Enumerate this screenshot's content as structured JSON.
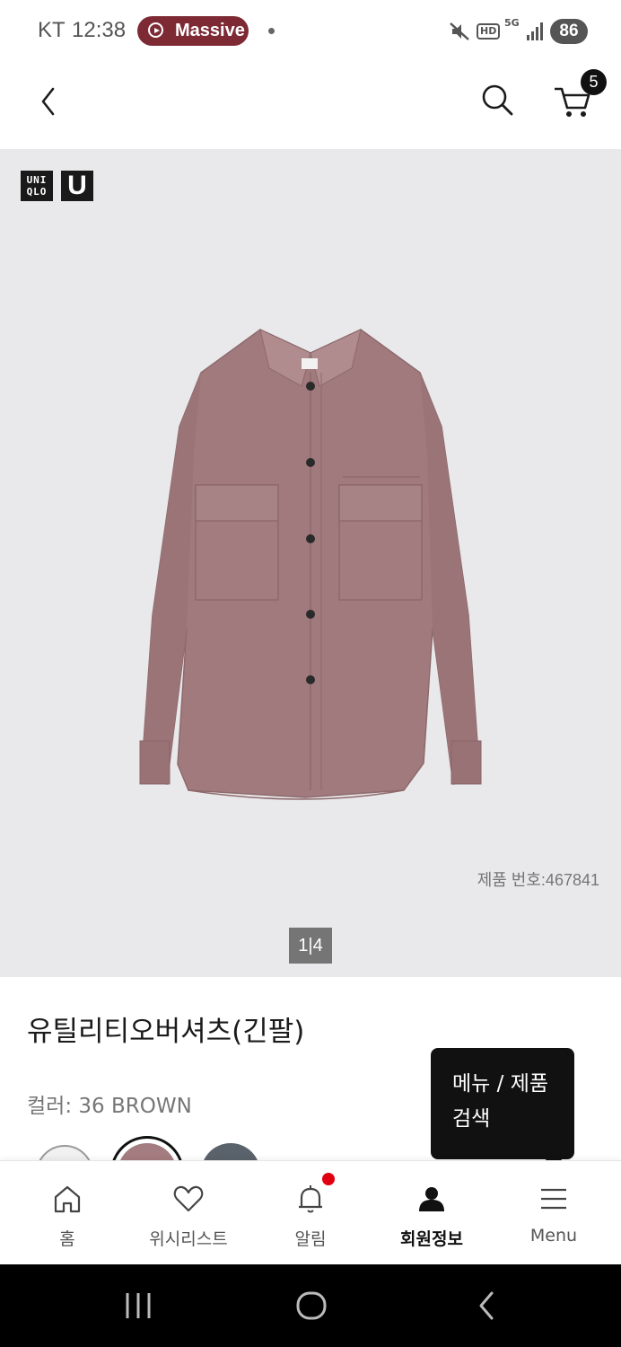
{
  "status_bar": {
    "carrier": "KT",
    "time": "12:38",
    "media_label": "Massive",
    "battery": "86",
    "hd": "HD",
    "network": "5G"
  },
  "header": {
    "cart_count": "5"
  },
  "product": {
    "brand_logo": "UNI QLO",
    "sub_logo": "U",
    "product_number": "제품 번호:467841",
    "pager": "1|4",
    "title": "유틸리티오버셔츠(긴팔)",
    "color_label": "컬러: 36 BROWN",
    "swatch_colors": [
      "#f1f1f1",
      "#a47d80",
      "#5a626b"
    ]
  },
  "tooltip": {
    "line1": "메뉴 / 제품",
    "line2": "검색"
  },
  "bottom_nav": {
    "items": [
      {
        "label": "홈",
        "icon": "home-icon"
      },
      {
        "label": "위시리스트",
        "icon": "heart-icon"
      },
      {
        "label": "알림",
        "icon": "bell-icon"
      },
      {
        "label": "회원정보",
        "icon": "person-icon"
      },
      {
        "label": "Menu",
        "icon": "menu-icon"
      }
    ]
  },
  "colors": {
    "brand_dark": "#111111",
    "notification": "#e00012",
    "media_chip": "#7d2a35",
    "image_bg": "#e9e9eb"
  }
}
